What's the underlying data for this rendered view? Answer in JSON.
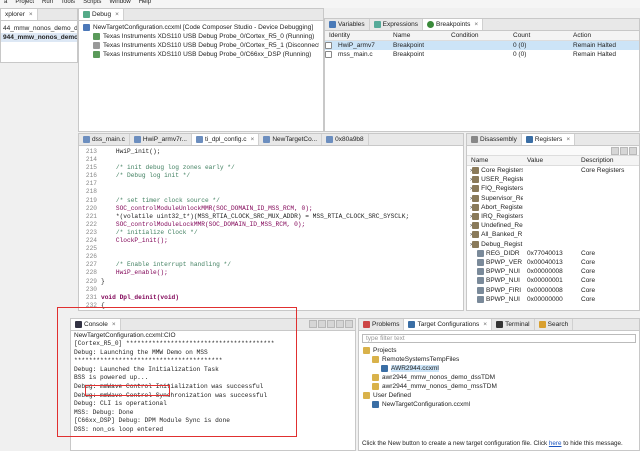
{
  "menubar": [
    "a",
    "Project",
    "Run",
    "Tools",
    "Scripts",
    "Window",
    "Help"
  ],
  "explorer": {
    "tab": "xplorer",
    "items": [
      "44_mmw_nonos_demo_dss",
      "944_mmw_nonos_demo_m"
    ]
  },
  "debug": {
    "tab": "Debug",
    "root": "NewTargetConfiguration.ccxml [Code Composer Studio - Device Debugging]",
    "cores": [
      "Texas Instruments XDS110 USB Debug Probe_0/Cortex_R5_0 (Running)",
      "Texas Instruments XDS110 USB Debug Probe_0/Cortex_R5_1 (Disconnected : Unkn",
      "Texas Instruments XDS110 USB Debug Probe_0/C66xx_DSP (Running)"
    ]
  },
  "breakpoints": {
    "tabs": [
      "Variables",
      "Expressions",
      "Breakpoints"
    ],
    "columns": [
      "Identity",
      "Name",
      "Condition",
      "Count",
      "Action"
    ],
    "rows": [
      {
        "identity": "HwiP_armv7",
        "name": "Breakpoint",
        "condition": "",
        "count": "0 (0)",
        "action": "Remain Halted"
      },
      {
        "identity": "mss_main.c",
        "name": "Breakpoint",
        "condition": "",
        "count": "0 (0)",
        "action": "Remain Halted"
      }
    ]
  },
  "editor": {
    "tabs": [
      "dss_main.c",
      "HwiP_armv7r...",
      "ti_dpl_config.c",
      "NewTargetCo...",
      "0x80a9b8"
    ],
    "lines": [
      {
        "n": "213",
        "t": "    HwiP_init();",
        "c": ""
      },
      {
        "n": "214",
        "t": "",
        "c": ""
      },
      {
        "n": "215",
        "t": "    /* init debug log zones early */",
        "c": "cm"
      },
      {
        "n": "216",
        "t": "    /* Debug log init */",
        "c": "cm"
      },
      {
        "n": "217",
        "t": "",
        "c": ""
      },
      {
        "n": "218",
        "t": "",
        "c": ""
      },
      {
        "n": "219",
        "t": "    /* set timer clock source */",
        "c": "cm"
      },
      {
        "n": "220",
        "t": "    SOC_controlModuleUnlockMMR(SOC_DOMAIN_ID_MSS_RCM, 0);",
        "c": "fn"
      },
      {
        "n": "221",
        "t": "    *(volatile uint32_t*)(MSS_RTIA_CLOCK_SRC_MUX_ADDR) = MSS_RTIA_CLOCK_SRC_SYSCLK;",
        "c": ""
      },
      {
        "n": "222",
        "t": "    SOC_controlModuleLockMMR(SOC_DOMAIN_ID_MSS_RCM, 0);",
        "c": "fn"
      },
      {
        "n": "223",
        "t": "    /* initialize Clock */",
        "c": "cm"
      },
      {
        "n": "224",
        "t": "    ClockP_init();",
        "c": "fn"
      },
      {
        "n": "225",
        "t": "",
        "c": ""
      },
      {
        "n": "226",
        "t": "",
        "c": ""
      },
      {
        "n": "227",
        "t": "    /* Enable interrupt handling */",
        "c": "cm"
      },
      {
        "n": "228",
        "t": "    HwiP_enable();",
        "c": "fn"
      },
      {
        "n": "229",
        "t": "}",
        "c": ""
      },
      {
        "n": "230",
        "t": "",
        "c": ""
      },
      {
        "n": "231",
        "t": "void Dpl_deinit(void)",
        "c": "kw"
      },
      {
        "n": "232",
        "t": "{",
        "c": ""
      },
      {
        "n": "233",
        "t": "",
        "c": ""
      }
    ]
  },
  "registers": {
    "tabs": [
      "Disassembly",
      "Registers"
    ],
    "columns": [
      "Name",
      "Value",
      "Description"
    ],
    "rows": [
      {
        "name": "Core Registers",
        "value": "",
        "desc": "Core Registers",
        "group": true
      },
      {
        "name": "USER_Registers",
        "value": "",
        "desc": "",
        "group": true
      },
      {
        "name": "FIQ_Registers",
        "value": "",
        "desc": "",
        "group": true
      },
      {
        "name": "Supervisor_Re",
        "value": "",
        "desc": "",
        "group": true
      },
      {
        "name": "Abort_Registers",
        "value": "",
        "desc": "",
        "group": true
      },
      {
        "name": "IRQ_Registers",
        "value": "",
        "desc": "",
        "group": true
      },
      {
        "name": "Undefined_Re",
        "value": "",
        "desc": "",
        "group": true
      },
      {
        "name": "All_Banked_R",
        "value": "",
        "desc": "",
        "group": true
      },
      {
        "name": "Debug_Regist",
        "value": "",
        "desc": "",
        "group": true
      },
      {
        "name": "REG_DIDR",
        "value": "0x77040013",
        "desc": "Core",
        "group": false
      },
      {
        "name": "BPWP_VER",
        "value": "0x00040013",
        "desc": "Core",
        "group": false
      },
      {
        "name": "BPWP_NUI",
        "value": "0x00000008",
        "desc": "Core",
        "group": false
      },
      {
        "name": "BPWP_NUI",
        "value": "0x00000001",
        "desc": "Core",
        "group": false
      },
      {
        "name": "BPWP_FIRI",
        "value": "0x00000008",
        "desc": "Core",
        "group": false
      },
      {
        "name": "BPWP_NUI",
        "value": "0x00000000",
        "desc": "Core",
        "group": false
      }
    ]
  },
  "console": {
    "tab": "Console",
    "title": "NewTargetConfiguration.ccxml:CIO",
    "lines": [
      "[Cortex_R5_0] ****************************************",
      "Debug: Launching the MMW Demo on MSS",
      "****************************************",
      "Debug: Launched the Initialization Task",
      "BSS is powered up...",
      "Debug: mmWave Control Initialization was successful",
      "Debug: mmWave Control Synchronization was successful",
      "Debug: CLI is operational",
      "MSS: Debug: Done",
      "[C66xx_DSP] Debug: DPM Module Sync is done",
      "DSS: non_os loop entered"
    ]
  },
  "targets": {
    "tabs": [
      "Problems",
      "Target Configurations",
      "Terminal",
      "Search"
    ],
    "filter_placeholder": "type filter text",
    "tree": [
      {
        "label": "Projects",
        "level": 0
      },
      {
        "label": "RemoteSystemsTempFiles",
        "level": 1
      },
      {
        "label": "AWR2944.ccxml",
        "level": 2
      },
      {
        "label": "awr2944_mmw_nonos_demo_dssTDM",
        "level": 1
      },
      {
        "label": "awr2944_mmw_nonos_demo_mssTDM",
        "level": 1
      },
      {
        "label": "User Defined",
        "level": 0
      },
      {
        "label": "NewTargetConfiguration.ccxml",
        "level": 1
      }
    ],
    "footer_pre": "Click the New button to create a new target configuration file. Click",
    "footer_link": "here",
    "footer_post": "to hide this message."
  },
  "colors": {
    "highlight": "#e03030",
    "selection": "#cce4f7",
    "accent": "#3a6ea5"
  }
}
